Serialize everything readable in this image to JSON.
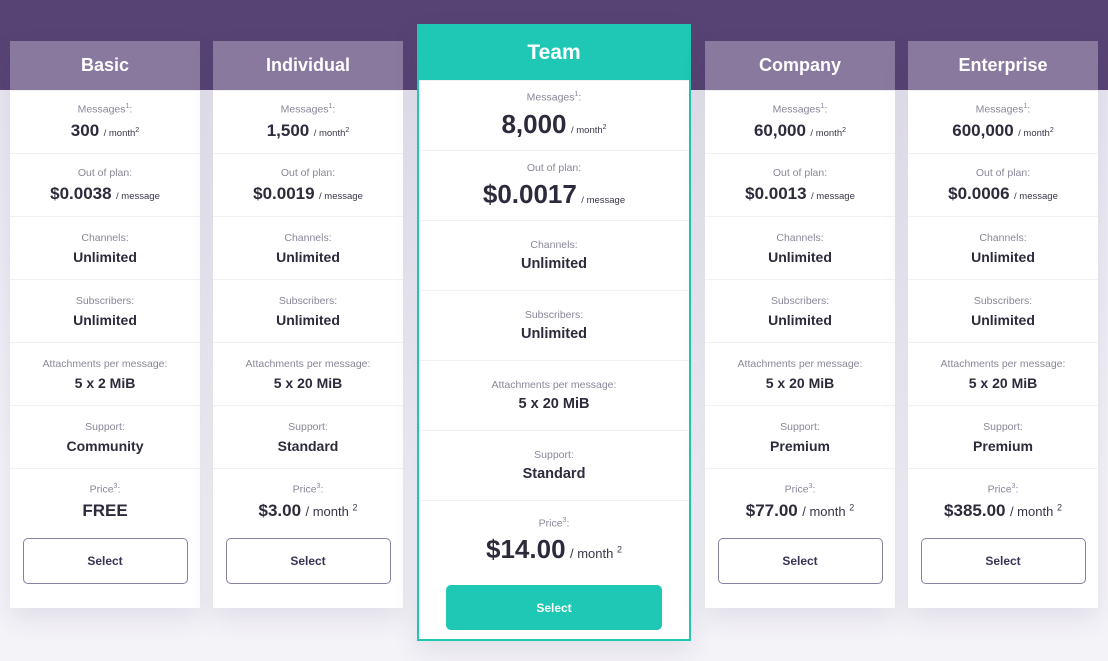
{
  "colors": {
    "header_band": "#584474",
    "plan_header": "#8a799f",
    "featured_accent": "#1fc8b4",
    "text_dark": "#2e2a3c",
    "label_gray": "#8b8699"
  },
  "labels": {
    "messages": "Messages",
    "messages_note": "1",
    "out_of_plan": "Out of plan:",
    "channels": "Channels:",
    "subscribers": "Subscribers:",
    "attachments": "Attachments per message:",
    "support": "Support:",
    "price": "Price",
    "price_note": "3",
    "colon": ":",
    "per_month": "/ month",
    "month_note": "2",
    "per_message": "/ message"
  },
  "plans": [
    {
      "name": "Basic",
      "messages": "300",
      "out_of_plan": "$0.0038",
      "channels": "Unlimited",
      "subscribers": "Unlimited",
      "attachments": "5 x 2 MiB",
      "support": "Community",
      "price": "FREE",
      "price_unit": "",
      "price_note": "",
      "button": "Select",
      "featured": false
    },
    {
      "name": "Individual",
      "messages": "1,500",
      "out_of_plan": "$0.0019",
      "channels": "Unlimited",
      "subscribers": "Unlimited",
      "attachments": "5 x 20 MiB",
      "support": "Standard",
      "price": "$3.00",
      "price_unit": "/ month",
      "price_note": "2",
      "button": "Select",
      "featured": false
    },
    {
      "name": "Team",
      "messages": "8,000",
      "out_of_plan": "$0.0017",
      "channels": "Unlimited",
      "subscribers": "Unlimited",
      "attachments": "5 x 20 MiB",
      "support": "Standard",
      "price": "$14.00",
      "price_unit": "/ month",
      "price_note": "2",
      "button": "Select",
      "featured": true
    },
    {
      "name": "Company",
      "messages": "60,000",
      "out_of_plan": "$0.0013",
      "channels": "Unlimited",
      "subscribers": "Unlimited",
      "attachments": "5 x 20 MiB",
      "support": "Premium",
      "price": "$77.00",
      "price_unit": "/ month",
      "price_note": "2",
      "button": "Select",
      "featured": false
    },
    {
      "name": "Enterprise",
      "messages": "600,000",
      "out_of_plan": "$0.0006",
      "channels": "Unlimited",
      "subscribers": "Unlimited",
      "attachments": "5 x 20 MiB",
      "support": "Premium",
      "price": "$385.00",
      "price_unit": "/ month",
      "price_note": "2",
      "button": "Select",
      "featured": false
    }
  ]
}
